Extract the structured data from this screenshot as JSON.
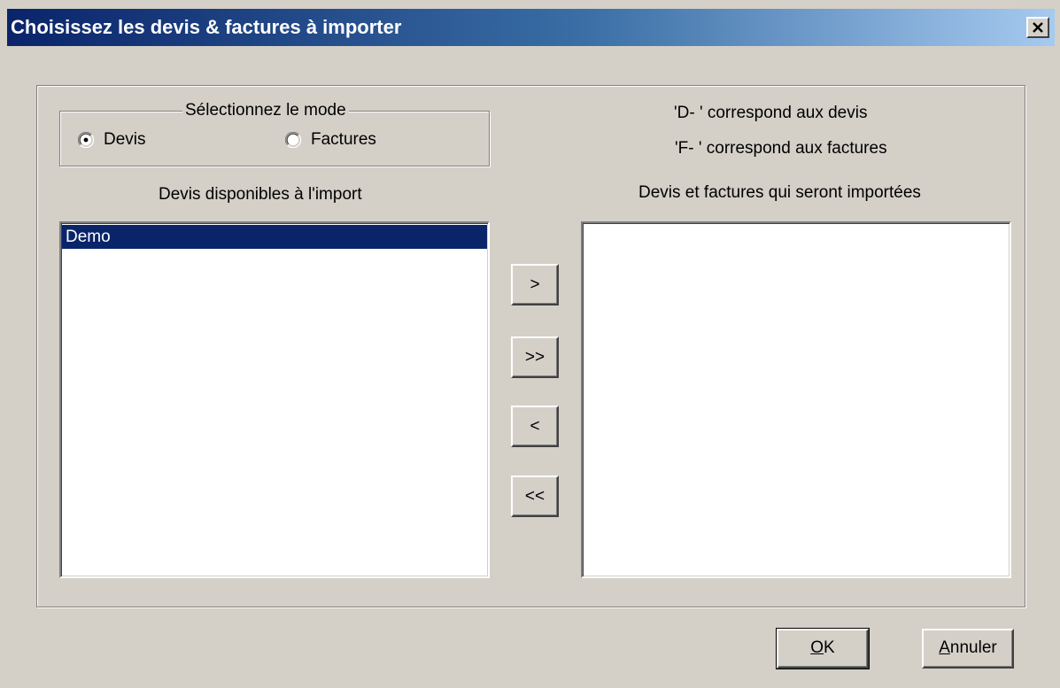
{
  "window": {
    "title": "Choisissez les devis & factures à importer",
    "close_label": "×"
  },
  "mode_group": {
    "legend": "Sélectionnez le mode",
    "options": [
      {
        "label": "Devis",
        "selected": true
      },
      {
        "label": "Factures",
        "selected": false
      }
    ]
  },
  "legend_info": {
    "line1": "'D- ' correspond aux devis",
    "line2": "'F- ' correspond aux factures"
  },
  "available": {
    "heading": "Devis disponibles à l'import",
    "items": [
      "Demo"
    ],
    "selected_index": 0
  },
  "to_import": {
    "heading": "Devis et factures qui seront importées",
    "items": []
  },
  "transfer_buttons": {
    "add_one": ">",
    "add_all": ">>",
    "remove_one": "<",
    "remove_all": "<<"
  },
  "dialog_buttons": {
    "ok_mnemonic": "O",
    "ok_rest": "K",
    "cancel_mnemonic": "A",
    "cancel_rest": "nnuler"
  },
  "colors": {
    "title_start": "#0a246a",
    "title_end": "#a6caf0",
    "selection": "#0a246a",
    "face": "#d4d0c8"
  }
}
